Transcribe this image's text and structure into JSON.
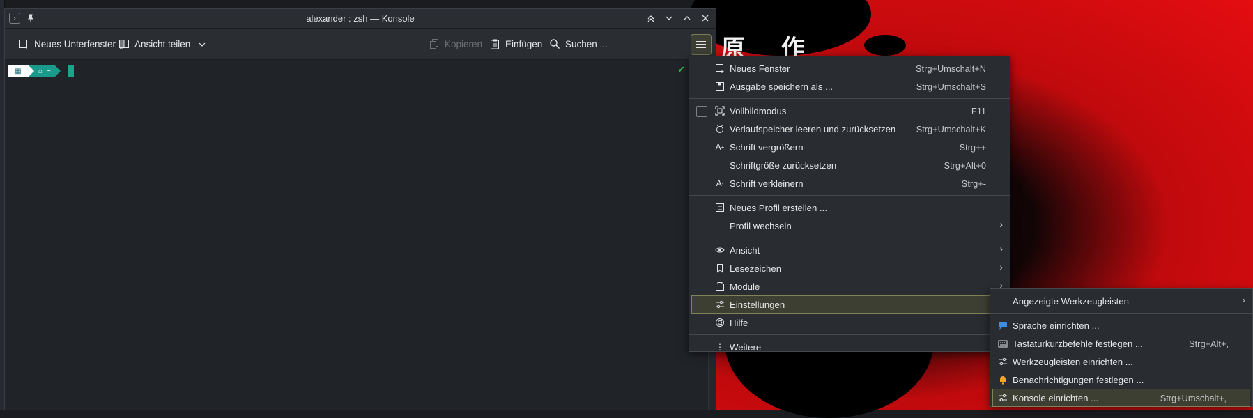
{
  "window": {
    "title": "alexander : zsh — Konsole"
  },
  "toolbar": {
    "new_tab": "Neues Unterfenster",
    "split_view": "Ansicht teilen",
    "copy": "Kopieren",
    "paste": "Einfügen",
    "search": "Suchen ..."
  },
  "terminal": {
    "prompt_dir": "~"
  },
  "main_menu": {
    "items": [
      {
        "label": "Neues Fenster",
        "shortcut": "Strg+Umschalt+N",
        "icon": "new-window-icon"
      },
      {
        "label": "Ausgabe speichern als ...",
        "shortcut": "Strg+Umschalt+S",
        "icon": "save-output-icon"
      },
      {
        "label": "Vollbildmodus",
        "shortcut": "F11",
        "icon": "fullscreen-icon"
      },
      {
        "label": "Verlaufspeicher leeren und zurücksetzen",
        "shortcut": "Strg+Umschalt+K",
        "icon": "clear-history-icon"
      },
      {
        "label": "Schrift vergrößern",
        "shortcut": "Strg++",
        "icon": "font-bigger-icon"
      },
      {
        "label": "Schriftgröße zurücksetzen",
        "shortcut": "Strg+Alt+0",
        "icon": ""
      },
      {
        "label": "Schrift verkleinern",
        "shortcut": "Strg+-",
        "icon": "font-smaller-icon"
      },
      {
        "label": "Neues Profil erstellen ...",
        "shortcut": "",
        "icon": "new-profile-icon"
      },
      {
        "label": "Profil wechseln",
        "shortcut": "",
        "icon": ""
      },
      {
        "label": "Ansicht",
        "shortcut": "",
        "icon": "eye-icon"
      },
      {
        "label": "Lesezeichen",
        "shortcut": "",
        "icon": "bookmark-icon"
      },
      {
        "label": "Module",
        "shortcut": "",
        "icon": "plugins-icon"
      },
      {
        "label": "Einstellungen",
        "shortcut": "",
        "icon": "settings-sliders-icon"
      },
      {
        "label": "Hilfe",
        "shortcut": "",
        "icon": "help-icon"
      },
      {
        "label": "Weitere",
        "shortcut": "",
        "icon": "more-icon"
      }
    ]
  },
  "sub_menu": {
    "items": [
      {
        "label": "Angezeigte Werkzeugleisten",
        "shortcut": ""
      },
      {
        "label": "Sprache einrichten ...",
        "shortcut": ""
      },
      {
        "label": "Tastaturkurzbefehle festlegen ...",
        "shortcut": "Strg+Alt+,"
      },
      {
        "label": "Werkzeugleisten einrichten ...",
        "shortcut": ""
      },
      {
        "label": "Benachrichtigungen festlegen ...",
        "shortcut": ""
      },
      {
        "label": "Konsole einrichten ...",
        "shortcut": "Strg+Umschalt+,"
      }
    ]
  },
  "wallpaper": {
    "kanji": "原 作"
  },
  "colors": {
    "accent_highlight": "#3e3f33",
    "prompt_teal": "#1a9a8a",
    "wallpaper_red": "#e40d10"
  }
}
